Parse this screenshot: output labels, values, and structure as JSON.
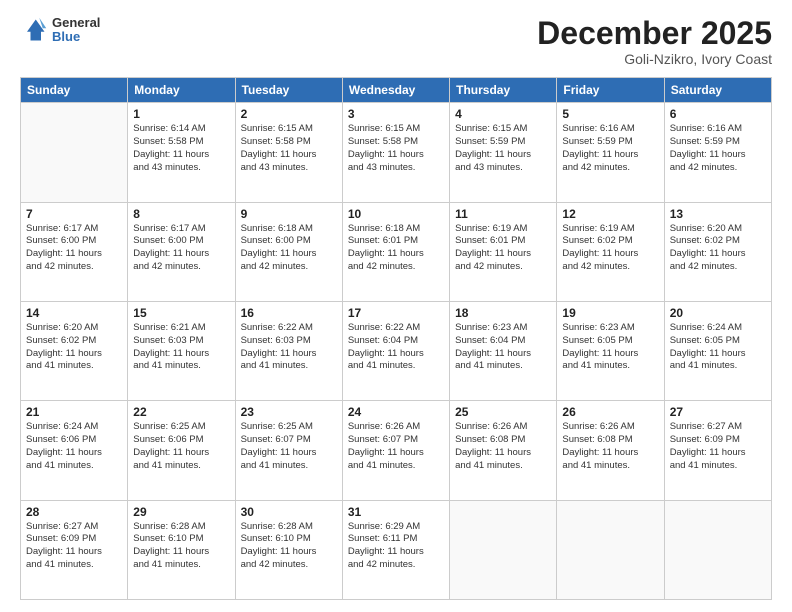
{
  "logo": {
    "general": "General",
    "blue": "Blue"
  },
  "header": {
    "month": "December 2025",
    "location": "Goli-Nzikro, Ivory Coast"
  },
  "weekdays": [
    "Sunday",
    "Monday",
    "Tuesday",
    "Wednesday",
    "Thursday",
    "Friday",
    "Saturday"
  ],
  "weeks": [
    [
      {
        "day": "",
        "detail": ""
      },
      {
        "day": "1",
        "detail": "Sunrise: 6:14 AM\nSunset: 5:58 PM\nDaylight: 11 hours\nand 43 minutes."
      },
      {
        "day": "2",
        "detail": "Sunrise: 6:15 AM\nSunset: 5:58 PM\nDaylight: 11 hours\nand 43 minutes."
      },
      {
        "day": "3",
        "detail": "Sunrise: 6:15 AM\nSunset: 5:58 PM\nDaylight: 11 hours\nand 43 minutes."
      },
      {
        "day": "4",
        "detail": "Sunrise: 6:15 AM\nSunset: 5:59 PM\nDaylight: 11 hours\nand 43 minutes."
      },
      {
        "day": "5",
        "detail": "Sunrise: 6:16 AM\nSunset: 5:59 PM\nDaylight: 11 hours\nand 42 minutes."
      },
      {
        "day": "6",
        "detail": "Sunrise: 6:16 AM\nSunset: 5:59 PM\nDaylight: 11 hours\nand 42 minutes."
      }
    ],
    [
      {
        "day": "7",
        "detail": "Sunrise: 6:17 AM\nSunset: 6:00 PM\nDaylight: 11 hours\nand 42 minutes."
      },
      {
        "day": "8",
        "detail": "Sunrise: 6:17 AM\nSunset: 6:00 PM\nDaylight: 11 hours\nand 42 minutes."
      },
      {
        "day": "9",
        "detail": "Sunrise: 6:18 AM\nSunset: 6:00 PM\nDaylight: 11 hours\nand 42 minutes."
      },
      {
        "day": "10",
        "detail": "Sunrise: 6:18 AM\nSunset: 6:01 PM\nDaylight: 11 hours\nand 42 minutes."
      },
      {
        "day": "11",
        "detail": "Sunrise: 6:19 AM\nSunset: 6:01 PM\nDaylight: 11 hours\nand 42 minutes."
      },
      {
        "day": "12",
        "detail": "Sunrise: 6:19 AM\nSunset: 6:02 PM\nDaylight: 11 hours\nand 42 minutes."
      },
      {
        "day": "13",
        "detail": "Sunrise: 6:20 AM\nSunset: 6:02 PM\nDaylight: 11 hours\nand 42 minutes."
      }
    ],
    [
      {
        "day": "14",
        "detail": "Sunrise: 6:20 AM\nSunset: 6:02 PM\nDaylight: 11 hours\nand 41 minutes."
      },
      {
        "day": "15",
        "detail": "Sunrise: 6:21 AM\nSunset: 6:03 PM\nDaylight: 11 hours\nand 41 minutes."
      },
      {
        "day": "16",
        "detail": "Sunrise: 6:22 AM\nSunset: 6:03 PM\nDaylight: 11 hours\nand 41 minutes."
      },
      {
        "day": "17",
        "detail": "Sunrise: 6:22 AM\nSunset: 6:04 PM\nDaylight: 11 hours\nand 41 minutes."
      },
      {
        "day": "18",
        "detail": "Sunrise: 6:23 AM\nSunset: 6:04 PM\nDaylight: 11 hours\nand 41 minutes."
      },
      {
        "day": "19",
        "detail": "Sunrise: 6:23 AM\nSunset: 6:05 PM\nDaylight: 11 hours\nand 41 minutes."
      },
      {
        "day": "20",
        "detail": "Sunrise: 6:24 AM\nSunset: 6:05 PM\nDaylight: 11 hours\nand 41 minutes."
      }
    ],
    [
      {
        "day": "21",
        "detail": "Sunrise: 6:24 AM\nSunset: 6:06 PM\nDaylight: 11 hours\nand 41 minutes."
      },
      {
        "day": "22",
        "detail": "Sunrise: 6:25 AM\nSunset: 6:06 PM\nDaylight: 11 hours\nand 41 minutes."
      },
      {
        "day": "23",
        "detail": "Sunrise: 6:25 AM\nSunset: 6:07 PM\nDaylight: 11 hours\nand 41 minutes."
      },
      {
        "day": "24",
        "detail": "Sunrise: 6:26 AM\nSunset: 6:07 PM\nDaylight: 11 hours\nand 41 minutes."
      },
      {
        "day": "25",
        "detail": "Sunrise: 6:26 AM\nSunset: 6:08 PM\nDaylight: 11 hours\nand 41 minutes."
      },
      {
        "day": "26",
        "detail": "Sunrise: 6:26 AM\nSunset: 6:08 PM\nDaylight: 11 hours\nand 41 minutes."
      },
      {
        "day": "27",
        "detail": "Sunrise: 6:27 AM\nSunset: 6:09 PM\nDaylight: 11 hours\nand 41 minutes."
      }
    ],
    [
      {
        "day": "28",
        "detail": "Sunrise: 6:27 AM\nSunset: 6:09 PM\nDaylight: 11 hours\nand 41 minutes."
      },
      {
        "day": "29",
        "detail": "Sunrise: 6:28 AM\nSunset: 6:10 PM\nDaylight: 11 hours\nand 41 minutes."
      },
      {
        "day": "30",
        "detail": "Sunrise: 6:28 AM\nSunset: 6:10 PM\nDaylight: 11 hours\nand 42 minutes."
      },
      {
        "day": "31",
        "detail": "Sunrise: 6:29 AM\nSunset: 6:11 PM\nDaylight: 11 hours\nand 42 minutes."
      },
      {
        "day": "",
        "detail": ""
      },
      {
        "day": "",
        "detail": ""
      },
      {
        "day": "",
        "detail": ""
      }
    ]
  ]
}
